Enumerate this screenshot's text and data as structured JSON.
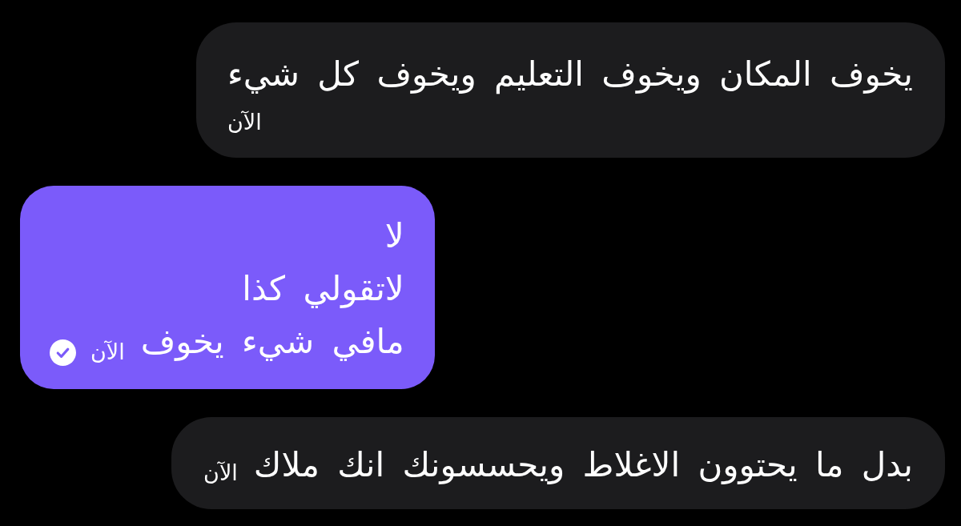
{
  "messages": [
    {
      "kind": "incoming",
      "lines": [
        "يخوف المكان ويخوف التعليم ويخوف كل شيء"
      ],
      "time": "الآن",
      "time_below": true,
      "read": false
    },
    {
      "kind": "outgoing",
      "lines": [
        "لا",
        "لاتقولي كذا",
        "مافي شيء يخوف"
      ],
      "time": "الآن",
      "time_below": false,
      "read": true
    },
    {
      "kind": "incoming",
      "lines": [
        "بدل ما يحتوون الاغلاط ويحسسونك انك ملاك"
      ],
      "time": "الآن",
      "time_below": false,
      "read": false
    }
  ]
}
